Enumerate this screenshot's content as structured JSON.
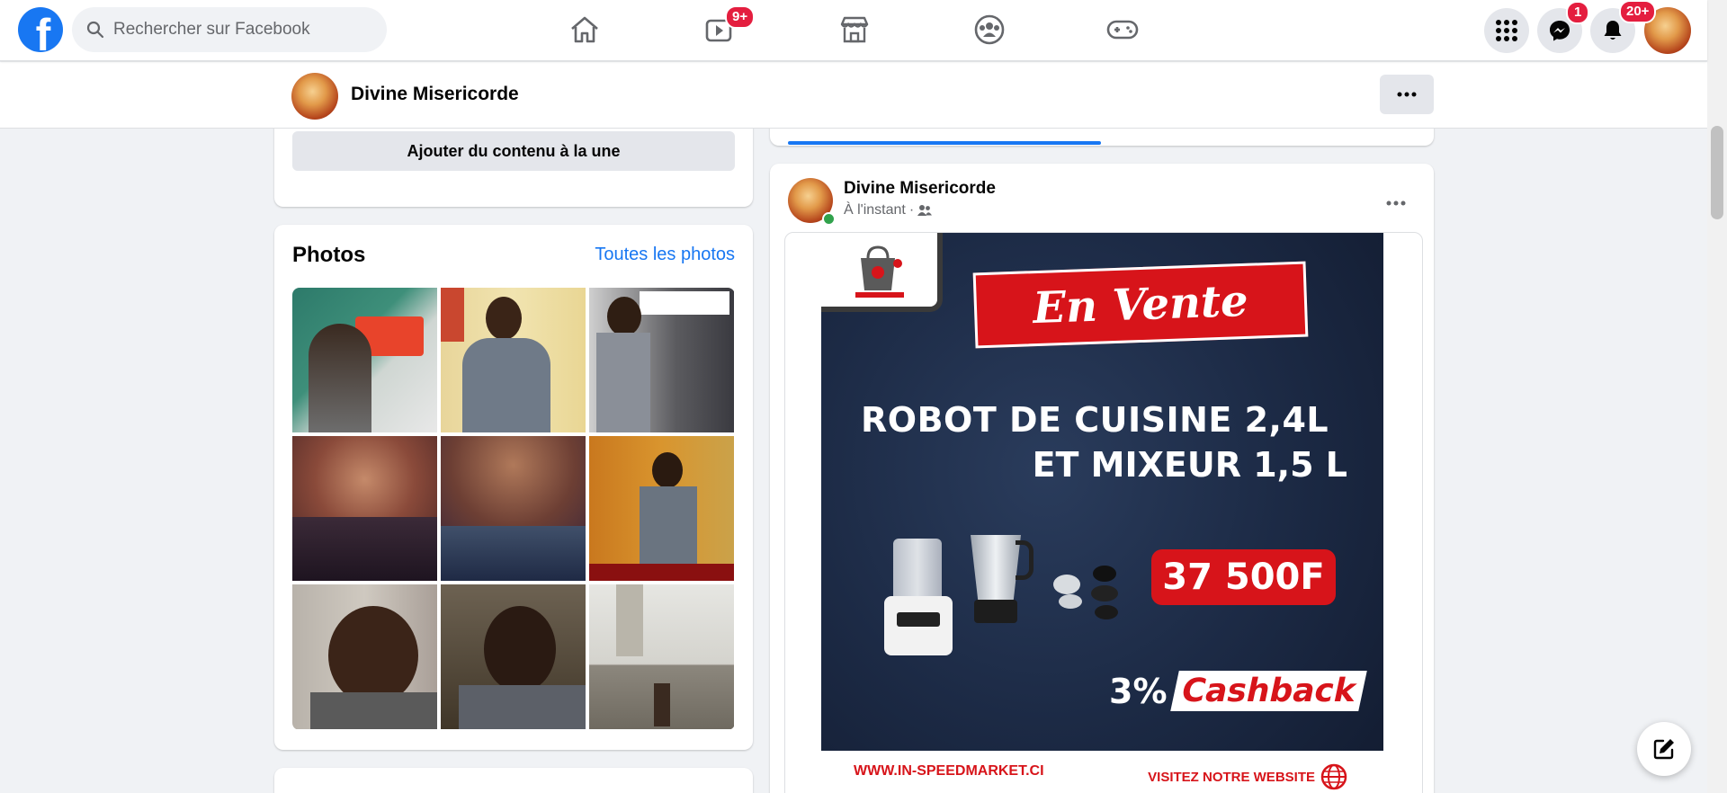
{
  "nav": {
    "logo_letter": "f",
    "search_placeholder": "Rechercher sur Facebook",
    "watch_badge": "9+",
    "messenger_badge": "1",
    "notifications_badge": "20+",
    "accent": "#1877f2",
    "badge_color": "#e41e3f"
  },
  "profile_bar": {
    "name": "Divine Misericorde",
    "more_label": "•••"
  },
  "featured": {
    "button_label": "Ajouter du contenu à la une"
  },
  "photos": {
    "title": "Photos",
    "see_all": "Toutes les photos",
    "items": [
      {
        "name": "photo-rti-stand"
      },
      {
        "name": "photo-man-badge"
      },
      {
        "name": "photo-cnmnt-booth"
      },
      {
        "name": "photo-event-hall-1"
      },
      {
        "name": "photo-event-hall-2"
      },
      {
        "name": "photo-150-banner"
      },
      {
        "name": "photo-selfie-1"
      },
      {
        "name": "photo-selfie-car"
      },
      {
        "name": "photo-building"
      }
    ]
  },
  "post": {
    "author": "Divine Misericorde",
    "time": "À l'instant",
    "separator": "·",
    "ad": {
      "headline": "En Vente",
      "title_line1": "ROBOT DE CUISINE 2,4L",
      "title_line2": "ET MIXEUR 1,5 L",
      "price": "37 500F",
      "cashback_pct": "3%",
      "cashback_label": "Cashback",
      "website": "WWW.IN-SPEEDMARKET.CI",
      "visit": "VISITEZ NOTRE WEBSITE"
    }
  }
}
